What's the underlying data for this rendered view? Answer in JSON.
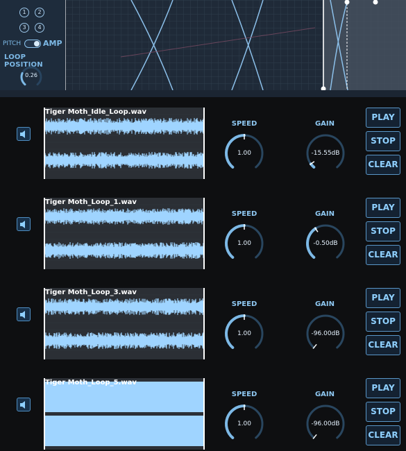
{
  "top": {
    "num_buttons": [
      "1",
      "2",
      "3",
      "4"
    ],
    "pitch_label": "PITCH",
    "amp_label": "AMP",
    "loop_position_label": "LOOP POSITION",
    "loop_position_value": "0.26",
    "loop_position_level": 0.26
  },
  "rows": [
    {
      "filename": "Tiger Moth_Idle_Loop.wav",
      "speed_label": "SPEED",
      "speed_value": "1.00",
      "gain_label": "GAIN",
      "gain_value": "-15.55dB",
      "play": "PLAY",
      "stop": "STOP",
      "clear": "CLEAR"
    },
    {
      "filename": "Tiger Moth_Loop_1.wav",
      "speed_label": "SPEED",
      "speed_value": "1.00",
      "gain_label": "GAIN",
      "gain_value": "-0.50dB",
      "play": "PLAY",
      "stop": "STOP",
      "clear": "CLEAR"
    },
    {
      "filename": "Tiger Moth_Loop_3.wav",
      "speed_label": "SPEED",
      "speed_value": "1.00",
      "gain_label": "GAIN",
      "gain_value": "-96.00dB",
      "play": "PLAY",
      "stop": "STOP",
      "clear": "CLEAR"
    },
    {
      "filename": "Tiger Moth_Loop_5.wav",
      "speed_label": "SPEED",
      "speed_value": "1.00",
      "gain_label": "GAIN",
      "gain_value": "-96.00dB",
      "play": "PLAY",
      "stop": "STOP",
      "clear": "CLEAR"
    }
  ],
  "icons": {
    "speaker": "speaker-icon"
  },
  "colors": {
    "accent": "#7db9e6",
    "waveform": "#9fd4ff",
    "background": "#0e0f11",
    "panel": "#1b2532"
  }
}
